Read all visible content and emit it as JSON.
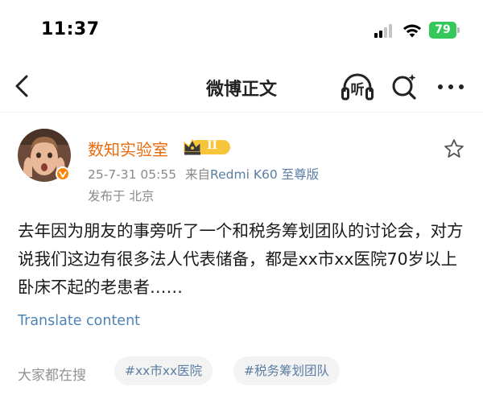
{
  "status_bar": {
    "time": "11:37",
    "battery": "79"
  },
  "nav": {
    "title": "微博正文",
    "listen_label": "听"
  },
  "post": {
    "user_name": "数知实验室",
    "vip_level": "II",
    "timestamp": "25-7-31 05:55",
    "source_prefix": "来自",
    "source_device": "Redmi K60 至尊版",
    "location": "发布于 北京",
    "text": "去年因为朋友的事旁听了一个和税务筹划团队的讨论会，对方说我们这边有很多法人代表储备，都是xx市xx医院70岁以上卧床不起的老患者……",
    "translate_label": "Translate content"
  },
  "hot_search": {
    "label": "大家都在搜",
    "tags": [
      "#xx市xx医院",
      "#税务筹划团队"
    ]
  },
  "colors": {
    "accent_orange": "#e86b0c",
    "link_blue": "#4d84b6",
    "battery_green": "#34c759"
  },
  "icons": [
    "back-icon",
    "listen-icon",
    "search-icon",
    "more-icon",
    "star-icon",
    "crown-icon",
    "verified-icon",
    "signal-icon",
    "wifi-icon",
    "battery-icon"
  ]
}
